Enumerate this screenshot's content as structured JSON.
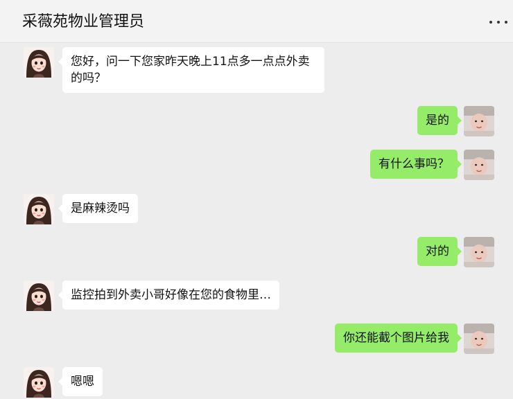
{
  "header": {
    "title": "采薇苑物业管理员"
  },
  "colors": {
    "background": "#ededed",
    "header_background": "#f3f3f3",
    "incoming_bubble": "#ffffff",
    "outgoing_bubble": "#95ec69"
  },
  "messages": [
    {
      "side": "left",
      "sender": "manager",
      "text": "您好，问一下您家昨天晚上11点多一点点外卖的吗？"
    },
    {
      "side": "right",
      "sender": "me",
      "text": "是的"
    },
    {
      "side": "right",
      "sender": "me",
      "text": "有什么事吗？"
    },
    {
      "side": "left",
      "sender": "manager",
      "text": "是麻辣烫吗"
    },
    {
      "side": "right",
      "sender": "me",
      "text": "对的"
    },
    {
      "side": "left",
      "sender": "manager",
      "text": "监控拍到外卖小哥好像在您的食物里…"
    },
    {
      "side": "right",
      "sender": "me",
      "text": "你还能截个图片给我"
    },
    {
      "side": "left",
      "sender": "manager",
      "text": "嗯嗯"
    }
  ],
  "icons": {
    "more": "more-dots-icon",
    "manager_avatar": "cartoon-girl-avatar",
    "my_avatar": "baby-photo-avatar"
  }
}
